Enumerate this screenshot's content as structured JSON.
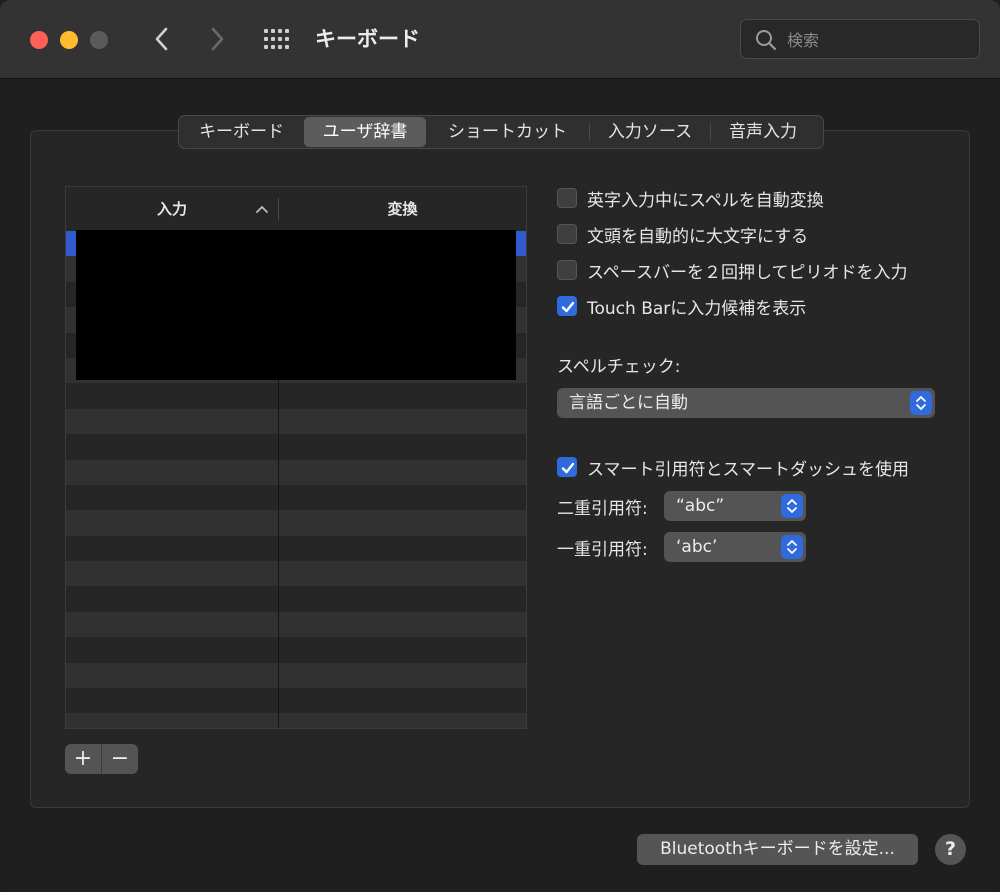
{
  "window": {
    "title": "キーボード",
    "search_placeholder": "検索"
  },
  "tabs": [
    {
      "label": "キーボード",
      "active": false
    },
    {
      "label": "ユーザ辞書",
      "active": true
    },
    {
      "label": "ショートカット",
      "active": false
    },
    {
      "label": "入力ソース",
      "active": false
    },
    {
      "label": "音声入力",
      "active": false
    }
  ],
  "table": {
    "col_input": "入力",
    "col_replace": "変換",
    "sort": "ascending",
    "rows": []
  },
  "table_controls": {
    "add": "+",
    "remove": "−"
  },
  "options": {
    "spell_auto": {
      "label": "英字入力中にスペルを自動変換",
      "checked": false
    },
    "capitalize": {
      "label": "文頭を自動的に大文字にする",
      "checked": false
    },
    "double_space": {
      "label": "スペースバーを２回押してピリオドを入力",
      "checked": false
    },
    "touchbar": {
      "label": "Touch Barに入力候補を表示",
      "checked": true
    },
    "spellcheck_label": "スペルチェック:",
    "spellcheck_value": "言語ごとに自動",
    "smart_quotes": {
      "label": "スマート引用符とスマートダッシュを使用",
      "checked": true
    },
    "double_quote_label": "二重引用符:",
    "double_quote_value": "“abc”",
    "single_quote_label": "一重引用符:",
    "single_quote_value": "‘abc’"
  },
  "footer": {
    "bluetooth_button": "Bluetoothキーボードを設定...",
    "help": "?"
  },
  "colors": {
    "accent": "#2f6bdc",
    "close": "#fe5f57",
    "minimize": "#febc2e"
  }
}
